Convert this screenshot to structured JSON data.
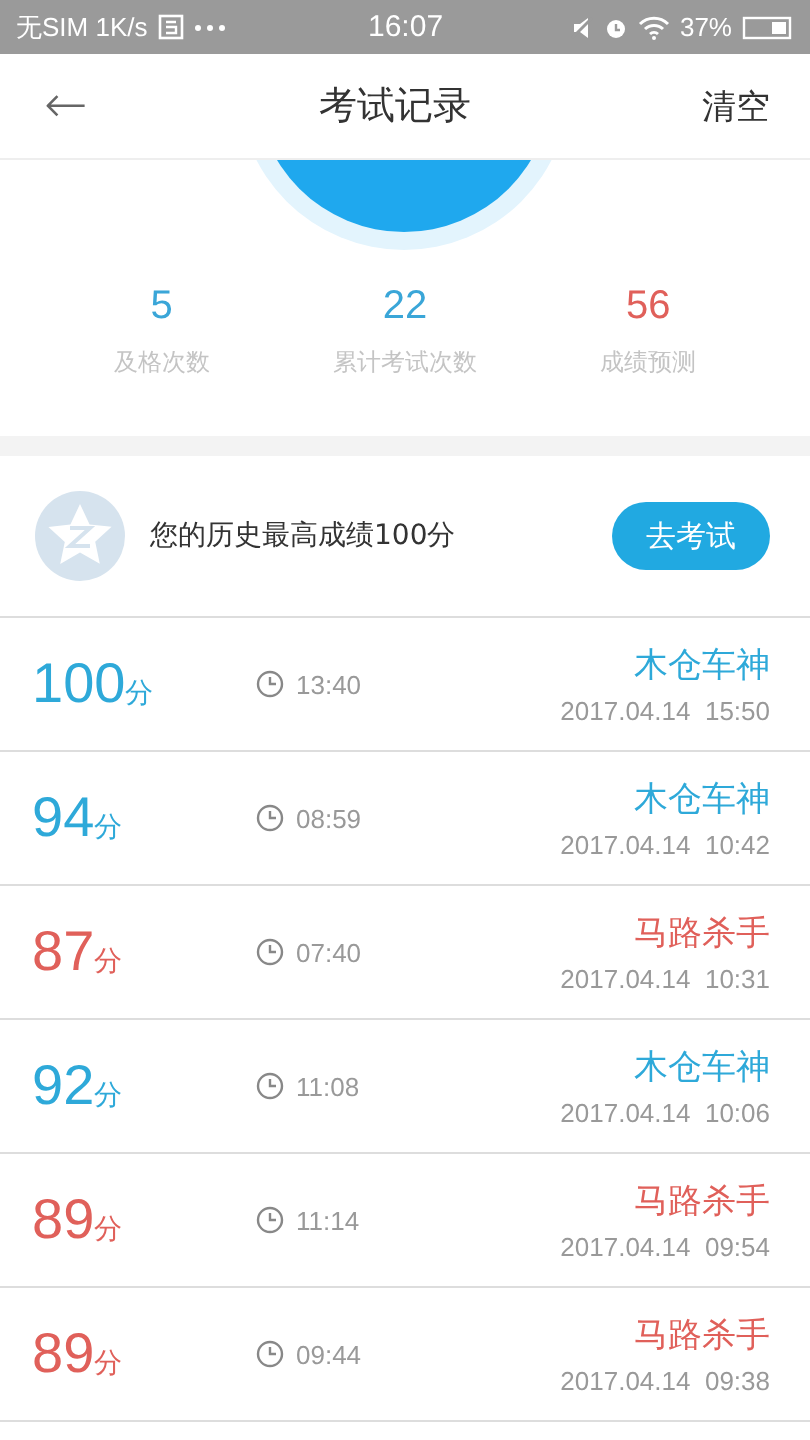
{
  "status_bar": {
    "carrier": "无SIM 1K/s",
    "time": "16:07",
    "battery": "37%"
  },
  "header": {
    "back": "←",
    "title": "考试记录",
    "action": "清空"
  },
  "stats": [
    {
      "value": "5",
      "label": "及格次数",
      "color": "#3aa6d8"
    },
    {
      "value": "22",
      "label": "累计考试次数",
      "color": "#3aa6d8"
    },
    {
      "value": "56",
      "label": "成绩预测",
      "color": "#e0605a"
    }
  ],
  "best": {
    "text": "您的历史最高成绩100分",
    "button": "去考试"
  },
  "records": [
    {
      "score": "100",
      "unit": "分",
      "duration": "13:40",
      "title": "木仓车神",
      "date": "2017.04.14  15:50",
      "passed": true
    },
    {
      "score": "94",
      "unit": "分",
      "duration": "08:59",
      "title": "木仓车神",
      "date": "2017.04.14  10:42",
      "passed": true
    },
    {
      "score": "87",
      "unit": "分",
      "duration": "07:40",
      "title": "马路杀手",
      "date": "2017.04.14  10:31",
      "passed": false
    },
    {
      "score": "92",
      "unit": "分",
      "duration": "11:08",
      "title": "木仓车神",
      "date": "2017.04.14  10:06",
      "passed": true
    },
    {
      "score": "89",
      "unit": "分",
      "duration": "11:14",
      "title": "马路杀手",
      "date": "2017.04.14  09:54",
      "passed": false
    },
    {
      "score": "89",
      "unit": "分",
      "duration": "09:44",
      "title": "马路杀手",
      "date": "2017.04.14  09:38",
      "passed": false
    }
  ]
}
